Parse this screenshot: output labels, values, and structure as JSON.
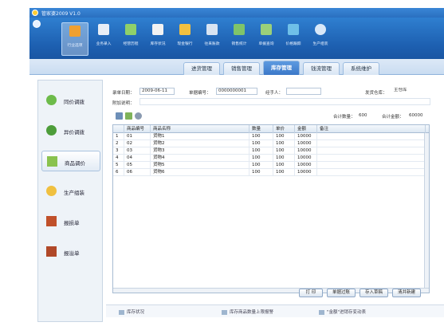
{
  "app": {
    "title": "管家婆2009 V1.0"
  },
  "toolbar": {
    "buttons": [
      {
        "label": "行业选项",
        "icon": "shop-icon",
        "color": "#f0a030"
      },
      {
        "label": "业务录入",
        "icon": "document-edit-icon",
        "color": "#e8eef6"
      },
      {
        "label": "经营历程",
        "icon": "chart-doc-icon",
        "color": "#8fd06a"
      },
      {
        "label": "库存状况",
        "icon": "warehouse-icon",
        "color": "#f2f2f2"
      },
      {
        "label": "现金银行",
        "icon": "coins-icon",
        "color": "#f2c040"
      },
      {
        "label": "往来账款",
        "icon": "ledger-icon",
        "color": "#d8e4f2"
      },
      {
        "label": "销售统计",
        "icon": "bar-chart-icon",
        "color": "#7fc46a"
      },
      {
        "label": "单据查询",
        "icon": "search-doc-icon",
        "color": "#9ad07a"
      },
      {
        "label": "价格跟踪",
        "icon": "price-tag-icon",
        "color": "#6fc0e8"
      },
      {
        "label": "生产组装",
        "icon": "gear-icon",
        "color": "#d8e8f8"
      }
    ]
  },
  "tabs": [
    {
      "label": "进货管理",
      "active": false
    },
    {
      "label": "销售管理",
      "active": false
    },
    {
      "label": "库存管理",
      "active": true
    },
    {
      "label": "钱流管理",
      "active": false
    },
    {
      "label": "系统维护",
      "active": false
    }
  ],
  "sidebar": {
    "items": [
      {
        "label": "同价调拨",
        "icon": "transfer-icon",
        "active": false
      },
      {
        "label": "异价调拨",
        "icon": "exchange-icon",
        "active": false
      },
      {
        "label": "商品调价",
        "icon": "price-adjust-icon",
        "active": true
      },
      {
        "label": "生产组装",
        "icon": "assembly-icon",
        "active": false
      },
      {
        "label": "报损单",
        "icon": "loss-report-icon",
        "active": false
      },
      {
        "label": "报溢单",
        "icon": "overflow-report-icon",
        "active": false
      }
    ]
  },
  "form": {
    "date_label": "录单日期：",
    "date_value": "2009-06-11",
    "number_label": "单据编号：",
    "number_value": "0000000001",
    "handler_label": "经手人：",
    "handler_value": "",
    "warehouse_label": "发货仓库：",
    "warehouse_value": "主仓库",
    "note_label": "附加说明：",
    "note_value": ""
  },
  "totals": {
    "qty_label": "合计数量：",
    "qty_value": "600",
    "amount_label": "合计金额：",
    "amount_value": "60000"
  },
  "table": {
    "columns": [
      "",
      "商品编号",
      "商品名称",
      "数量",
      "单价",
      "金额",
      "备注"
    ],
    "rows": [
      [
        "1",
        "01",
        "货物1",
        "100",
        "100",
        "10000",
        ""
      ],
      [
        "2",
        "02",
        "货物2",
        "100",
        "100",
        "10000",
        ""
      ],
      [
        "3",
        "03",
        "货物3",
        "100",
        "100",
        "10000",
        ""
      ],
      [
        "4",
        "04",
        "货物4",
        "100",
        "100",
        "10000",
        ""
      ],
      [
        "5",
        "05",
        "货物5",
        "100",
        "100",
        "10000",
        ""
      ],
      [
        "6",
        "06",
        "货物6",
        "100",
        "100",
        "10000",
        ""
      ]
    ]
  },
  "buttons": {
    "print": "打 印",
    "save_draft": "单据过账",
    "save_as_draft": "存入草稿",
    "clear": "清并新建"
  },
  "footer": {
    "links": [
      "库存状况",
      "库存商品数量上限报警",
      "\"金额\"进销存变动表"
    ]
  },
  "colors": {
    "accent": "#2a6fc0",
    "tab_active": "#3b78c8"
  }
}
